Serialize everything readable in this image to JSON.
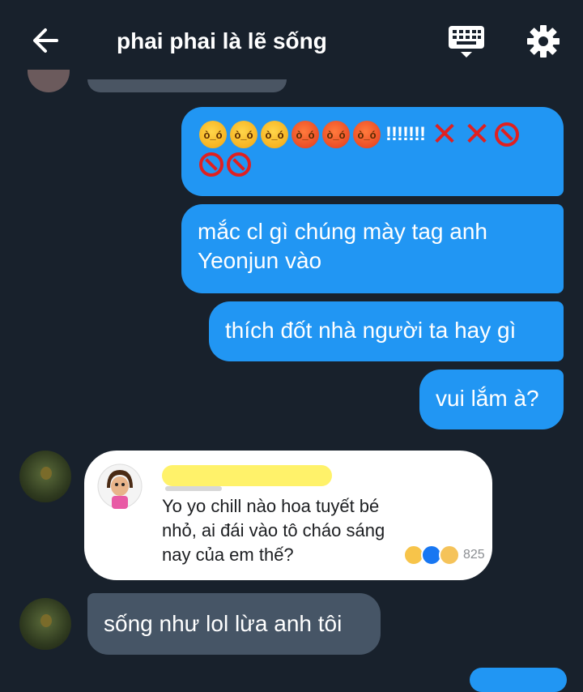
{
  "header": {
    "title": "phai phai là lẽ sống",
    "back_icon": "arrow-left-icon",
    "keyboard_icon": "keyboard-icon",
    "settings_icon": "gear-icon"
  },
  "messages": [
    {
      "direction": "outgoing",
      "type": "emoji-row",
      "content": [
        "😠",
        "😠",
        "😠",
        "😡",
        "😡",
        "😡",
        "!!!!!!!",
        "❌",
        "❌",
        "🚫",
        "🚫",
        "🚫"
      ],
      "bangs": "!!!!!!!"
    },
    {
      "direction": "outgoing",
      "text": "mắc cl gì chúng mày tag anh Yeonjun vào"
    },
    {
      "direction": "outgoing",
      "text": "thích đốt nhà người ta hay gì"
    },
    {
      "direction": "outgoing",
      "text": "vui lắm à?"
    },
    {
      "direction": "incoming",
      "type": "image",
      "image": {
        "comment": "Yo yo chill nào hoa tuyết bé nhỏ, ai đái vào tô cháo sáng nay của em thế?",
        "reaction_count": "825"
      }
    },
    {
      "direction": "incoming",
      "text": "sống như lol lừa anh tôi"
    }
  ],
  "colors": {
    "background": "#18212c",
    "outgoing": "#2196f3",
    "incoming": "#465566"
  }
}
